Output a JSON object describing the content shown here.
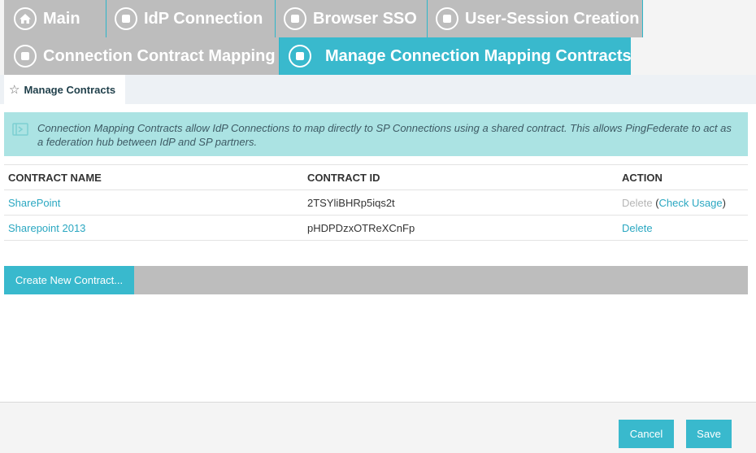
{
  "tabs": {
    "main": "Main",
    "idp_connection": "IdP Connection",
    "browser_sso": "Browser SSO",
    "user_session": "User-Session Creation",
    "contract_mapping": "Connection Contract Mapping",
    "manage_contracts_tab": "Manage Connection Mapping Contracts"
  },
  "subnav": {
    "label": "Manage Contracts"
  },
  "info": {
    "text": "Connection Mapping Contracts allow IdP Connections to map directly to SP Connections using a shared contract. This allows PingFederate to act as a federation hub between IdP and SP partners."
  },
  "table": {
    "headers": [
      "CONTRACT NAME",
      "CONTRACT ID",
      "ACTION"
    ],
    "rows": [
      {
        "name": "SharePoint",
        "id": "2TSYliBHRp5iqs2t",
        "delete": "Delete",
        "check_open": " (",
        "check_usage": "Check Usage",
        "check_close": ")"
      },
      {
        "name": "Sharepoint 2013",
        "id": "pHDPDzxOTReXCnFp",
        "delete": "Delete"
      }
    ]
  },
  "create_button": "Create New Contract...",
  "footer": {
    "cancel": "Cancel",
    "save": "Save"
  },
  "colors": {
    "accent": "#39b9cd",
    "tab_inactive": "#bdbdbd",
    "info_bg": "#abe3e3",
    "link": "#2aa7c1"
  }
}
